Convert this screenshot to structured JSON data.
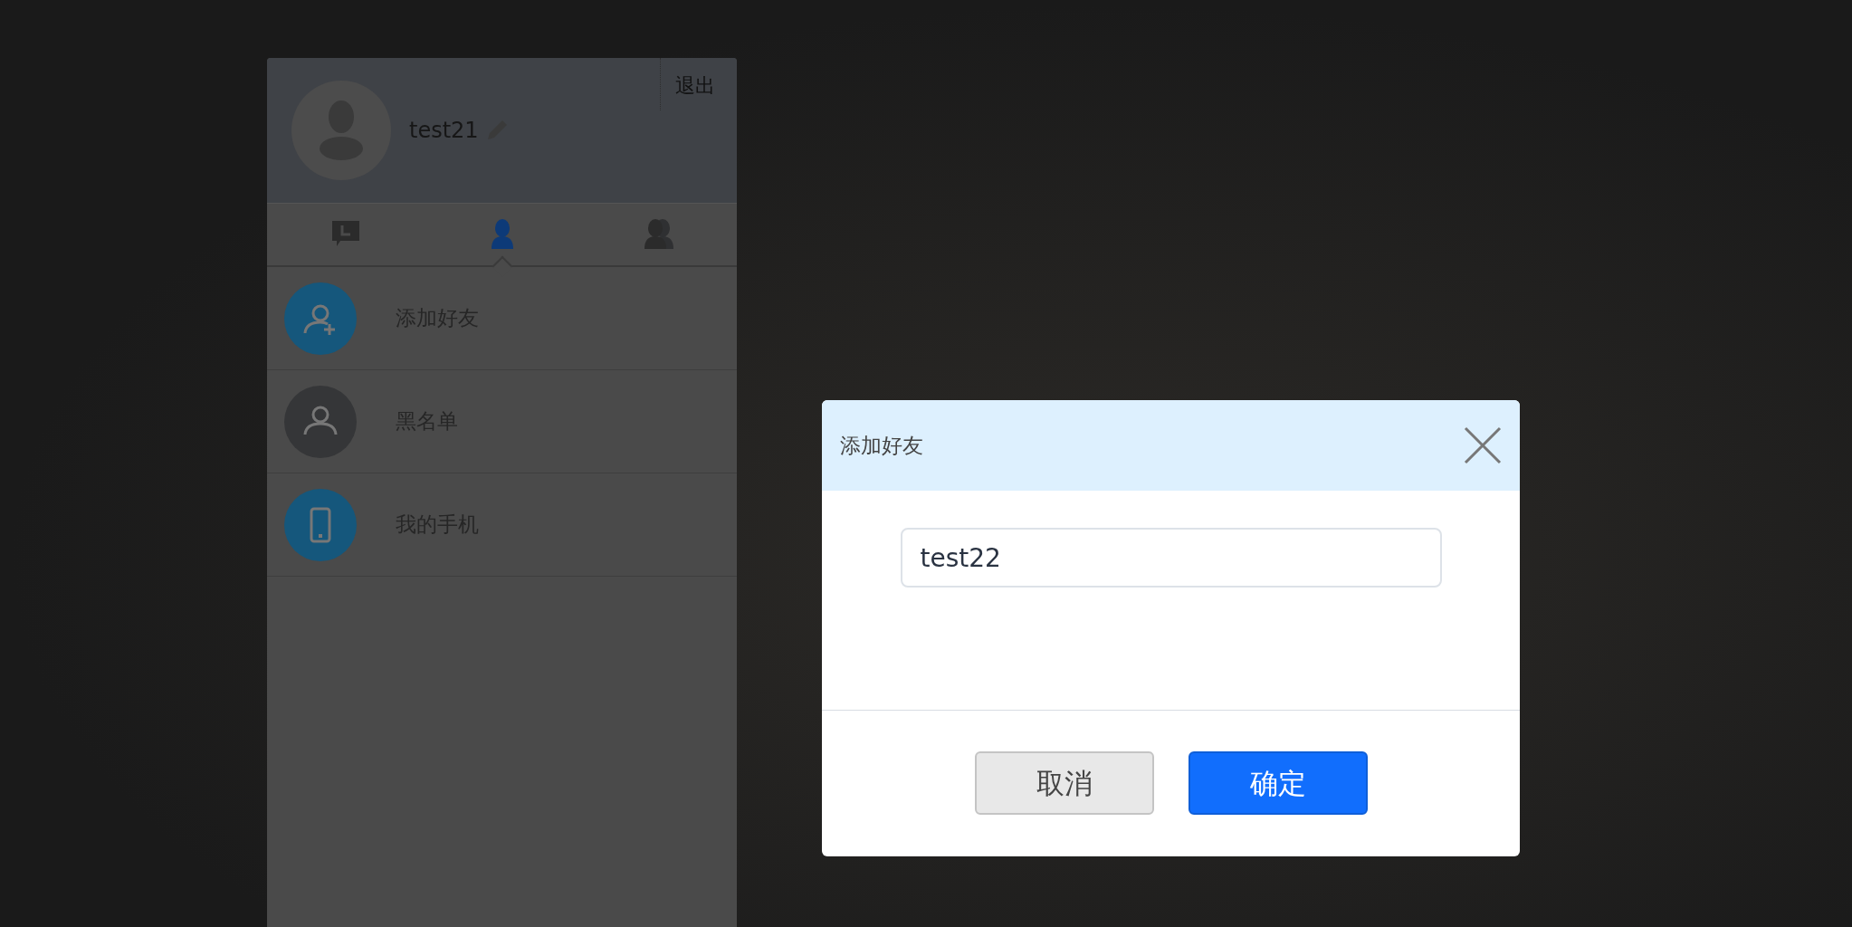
{
  "profile": {
    "username": "test21",
    "logout": "退出"
  },
  "tabs": [
    {
      "kind": "recent",
      "selected": false
    },
    {
      "kind": "contact",
      "selected": true
    },
    {
      "kind": "group",
      "selected": false
    }
  ],
  "list": [
    {
      "kind": "add-user",
      "label": "添加好友",
      "color": "#15577c"
    },
    {
      "kind": "user",
      "label": "黑名单",
      "color": "#353638"
    },
    {
      "kind": "phone",
      "label": "我的手机",
      "color": "#15577c"
    }
  ],
  "dialog": {
    "title": "添加好友",
    "input_value": "test22",
    "buttons": [
      {
        "label": "取消",
        "kind": "secondary"
      },
      {
        "label": "确定",
        "kind": "primary"
      }
    ]
  }
}
